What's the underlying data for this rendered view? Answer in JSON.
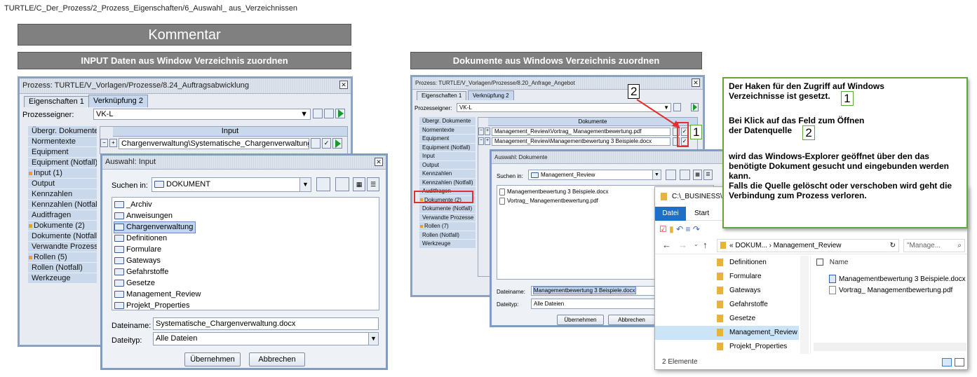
{
  "breadcrumb": "TURTLE/C_Der_Prozess/2_Prozess_Eigenschaften/6_Auswahl_ aus_Verzeichnissen",
  "kommentar": "Kommentar",
  "left_header": "INPUT Daten aus Window Verzeichnis zuordnen",
  "right_header": "Dokumente aus Windows Verzeichnis zuordnen",
  "left_window": {
    "title": "Prozess: TURTLE/V_Vorlagen/Prozesse/8.24_Auftragsabwicklung",
    "tabs": [
      "Eigenschaften 1",
      "Verknüpfung 2"
    ],
    "owner_label": "Prozesseigner:",
    "owner_value": "VK-L",
    "nav": [
      "Übergr. Dokumente",
      "Normentexte",
      "Equipment",
      "Equipment (Notfall)",
      "Input (1)",
      "Output",
      "Kennzahlen",
      "Kennzahlen (Notfall)",
      "Auditfragen",
      "Dokumente (2)",
      "Dokumente (Notfall)",
      "Verwandte Prozesse",
      "Rollen (5)",
      "Rollen (Notfall)",
      "Werkzeuge"
    ],
    "column": "Input",
    "row_value": "Chargenverwaltung\\Systematische_Chargenverwaltung.docx"
  },
  "left_dialog": {
    "title": "Auswahl: Input",
    "search_label": "Suchen in:",
    "search_value": "DOKUMENT",
    "folders": [
      "_Archiv",
      "Anweisungen",
      "Chargenverwaltung",
      "Definitionen",
      "Formulare",
      "Gateways",
      "Gefahrstoffe",
      "Gesetze",
      "Management_Review",
      "Projekt_Properties"
    ],
    "filename_label": "Dateiname:",
    "filename_value": "Systematische_Chargenverwaltung.docx",
    "filetype_label": "Dateityp:",
    "filetype_value": "Alle Dateien",
    "ok": "Übernehmen",
    "cancel": "Abbrechen"
  },
  "right_window": {
    "title": "Prozess: TURTLE/V_Vorlagen/Prozesse/8.20_Anfrage_Angebot",
    "tabs": [
      "Eigenschaften 1",
      "Verknüpfung 2"
    ],
    "owner_label": "Prozesseigner:",
    "owner_value": "VK-L",
    "nav": [
      "Übergr. Dokumente",
      "Normentexte",
      "Equipment",
      "Equipment (Notfall)",
      "Input",
      "Output",
      "Kennzahlen",
      "Kennzahlen (Notfall)",
      "Auditfragen",
      "Dokumente (2)",
      "Dokumente (Notfall)",
      "Verwandte Prozesse",
      "Rollen (7)",
      "Rollen (Notfall)",
      "Werkzeuge"
    ],
    "column": "Dokumente",
    "rows": [
      "Management_Review\\Vortrag_ Managementbewertung.pdf",
      "Management_Review\\Managementbewertung 3 Beispiele.docx"
    ]
  },
  "right_dialog": {
    "title": "Auswahl: Dokumente",
    "search_label": "Suchen in:",
    "search_value": "Management_Review",
    "files": [
      "Managementbewertung 3 Beispiele.docx",
      "Vortrag_ Managementbewertung.pdf"
    ],
    "filename_label": "Dateiname:",
    "filename_value": "Managementbewertung 3 Beispiele.docx",
    "filetype_label": "Dateityp:",
    "filetype_value": "Alle Dateien",
    "ok": "Übernehmen",
    "cancel": "Abbrechen"
  },
  "explorer": {
    "path_title": "C:\\_BUSINESS\\U",
    "ribbon_tabs": [
      "Datei",
      "Start"
    ],
    "address": [
      "DOKUM...",
      "Management_Review"
    ],
    "search_placeholder": "\"Manage...",
    "tree": [
      "Definitionen",
      "Formulare",
      "Gateways",
      "Gefahrstoffe",
      "Gesetze",
      "Management_Review",
      "Projekt_Properties"
    ],
    "column_name": "Name",
    "files": [
      "Managementbewertung 3 Beispiele.docx",
      "Vortrag_ Managementbewertung.pdf"
    ],
    "status": "2 Elemente"
  },
  "note": {
    "line1": "Der Haken für den Zugriff auf Windows",
    "line2": "Verzeichnisse ist gesetzt.",
    "num1": "1",
    "line3": "Bei Klick auf das Feld zum Öffnen",
    "line4": "der Datenquelle",
    "num2": "2",
    "line5": "wird das Windows-Explorer geöffnet über den das benötigte Dokument gesucht und eingebunden werden kann.",
    "line6": "Falls die Quelle gelöscht oder verschoben wird geht die Verbindung zum Prozess verloren."
  },
  "markers": [
    "1",
    "2"
  ]
}
